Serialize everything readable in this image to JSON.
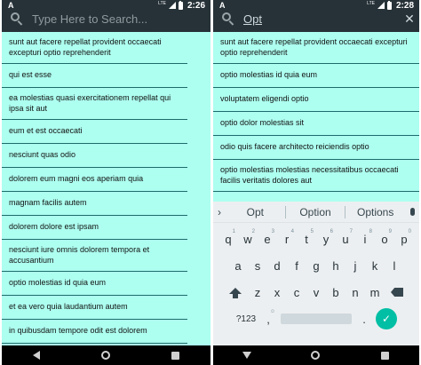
{
  "left": {
    "status": {
      "app_glyph": "A",
      "network": "LTE",
      "time": "2:26"
    },
    "search": {
      "placeholder": "Type Here to Search..."
    },
    "items": [
      "sunt aut facere repellat provident occaecati excepturi optio reprehenderit",
      "qui est esse",
      "ea molestias quasi exercitationem repellat qui ipsa sit aut",
      "eum et est occaecati",
      "nesciunt quas odio",
      "dolorem eum magni eos aperiam quia",
      "magnam facilis autem",
      "dolorem dolore est ipsam",
      "nesciunt iure omnis dolorem tempora et accusantium",
      "optio molestias id quia eum",
      "et ea vero quia laudantium autem",
      "in quibusdam tempore odit est dolorem"
    ]
  },
  "right": {
    "status": {
      "app_glyph": "A",
      "network": "LTE",
      "time": "2:28"
    },
    "search": {
      "value": "Opt",
      "close_symbol": "✕"
    },
    "items": [
      "sunt aut facere repellat provident occaecati excepturi optio reprehenderit",
      "optio molestias id quia eum",
      "voluptatem eligendi optio",
      "optio dolor molestias sit",
      "odio quis facere architecto reiciendis optio",
      "optio molestias molestias necessitatibus occaecati facilis veritatis dolores aut"
    ],
    "keyboard": {
      "chevron": "›",
      "suggestions": [
        "Opt",
        "Option",
        "Options"
      ],
      "row1": [
        "q",
        "w",
        "e",
        "r",
        "t",
        "y",
        "u",
        "i",
        "o",
        "p"
      ],
      "row1_hints": [
        "1",
        "2",
        "3",
        "4",
        "5",
        "6",
        "7",
        "8",
        "9",
        "0"
      ],
      "row2": [
        "a",
        "s",
        "d",
        "f",
        "g",
        "h",
        "j",
        "k",
        "l"
      ],
      "row3": [
        "z",
        "x",
        "c",
        "v",
        "b",
        "n",
        "m"
      ],
      "symbols_key": "?123",
      "comma_key": ",",
      "emoji_hint": "☺",
      "period_key": "."
    }
  },
  "colors": {
    "list_bg": "#adfff0",
    "toolbar_bg": "#263238",
    "accent": "#00bfa5"
  }
}
